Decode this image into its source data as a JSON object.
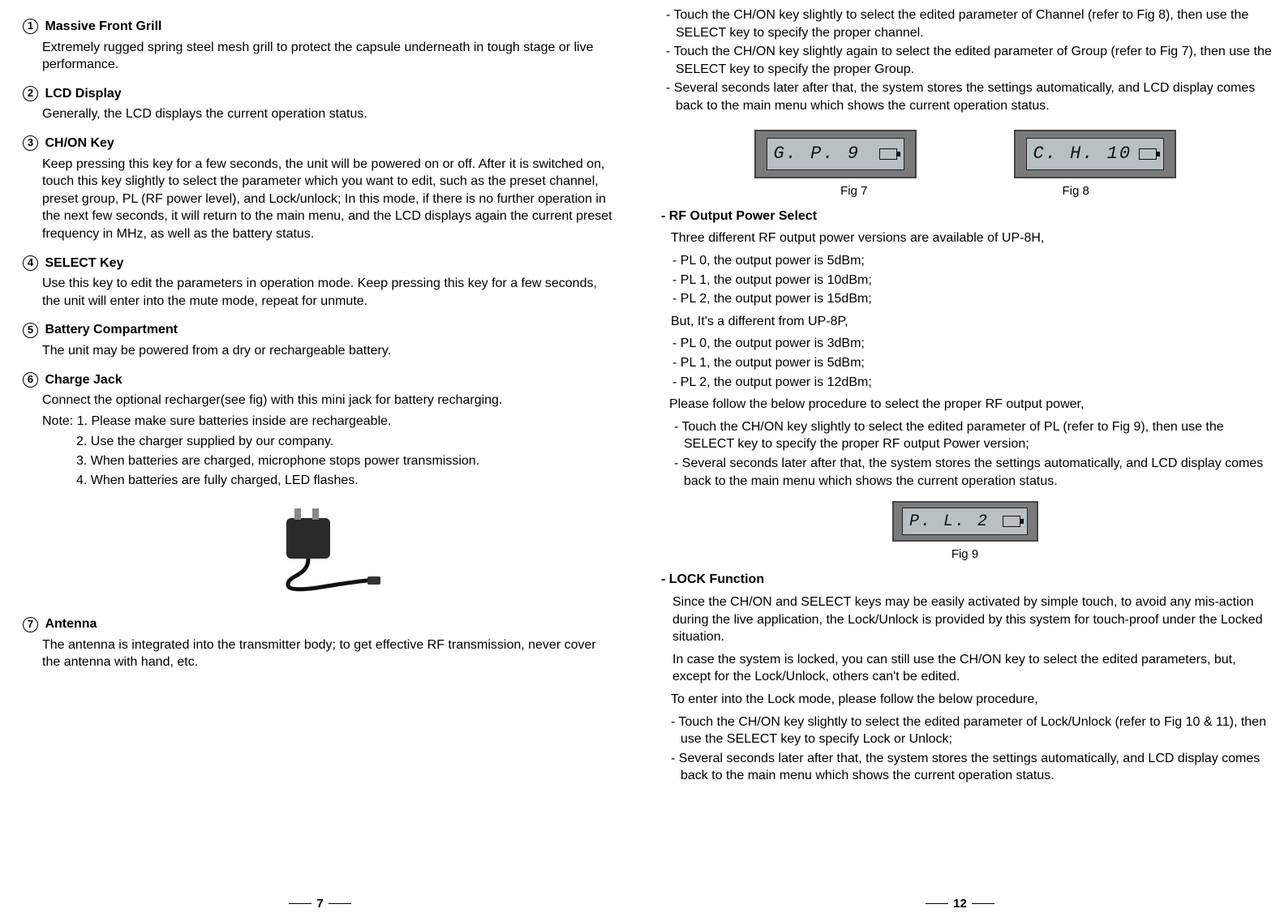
{
  "left": {
    "items": [
      {
        "num": "1",
        "title": "Massive Front Grill",
        "body": "Extremely rugged spring steel mesh grill to protect the capsule underneath in tough stage or live performance."
      },
      {
        "num": "2",
        "title": "LCD Display",
        "body": "Generally, the LCD displays the current operation status."
      },
      {
        "num": "3",
        "title": "CH/ON Key",
        "body": "Keep pressing this key for a few seconds, the unit will be powered on or off. After it is switched on, touch this key slightly to select the parameter which you want to edit, such as the preset channel, preset group, PL (RF power  level), and Lock/unlock; In this mode, if there is no further operation in the next few seconds, it will  return to the main menu, and the LCD displays again the current preset frequency in  MHz, as well as the battery status."
      },
      {
        "num": "4",
        "title": "SELECT Key",
        "body": "Use this key to edit the parameters in operation mode. Keep pressing this key for a few seconds, the unit will enter into the mute mode, repeat for unmute."
      },
      {
        "num": "5",
        "title": "Battery Compartment",
        "body": "The unit may be powered from a dry or rechargeable battery."
      },
      {
        "num": "6",
        "title": "Charge Jack",
        "body": "Connect the optional recharger(see fig) with this mini jack for battery recharging.",
        "note": "Note: 1. Please make sure batteries inside are rechargeable.",
        "note2": "2. Use the charger supplied by our company.",
        "note3": "3. When batteries are charged, microphone stops power transmission.",
        "note4": "4. When batteries are fully charged, LED flashes."
      },
      {
        "num": "7",
        "title": "Antenna",
        "body": "The antenna is integrated into the transmitter body; to get effective RF transmission, never cover the antenna with hand, etc."
      }
    ],
    "pagenum": "7"
  },
  "right": {
    "top": [
      "- Touch the CH/ON key slightly to select the edited parameter of Channel (refer to Fig 8), then  use the SELECT key to specify the proper channel.",
      "- Touch the CH/ON key slightly again to select the edited parameter of Group (refer to Fig 7), then use  the SELECT key to specify the proper Group.",
      "- Several seconds later after that, the system stores the settings automatically, and LCD display comes back to the main menu which shows the current operation status."
    ],
    "fig7_lcd": "G. P.      9",
    "fig8_lcd": "C. H.    10",
    "fig7": "Fig 7",
    "fig8": "Fig 8",
    "rf_title": "-  RF Output Power Select",
    "rf_intro": "Three different RF output power versions are available of UP-8H,",
    "rf_8h": [
      "- PL 0, the output power is 5dBm;",
      "- PL 1, the output power is 10dBm;",
      "- PL 2, the output power is 15dBm;"
    ],
    "rf_but": "But, It's a different from UP-8P,",
    "rf_8p": [
      "- PL 0, the output power is 3dBm;",
      "- PL 1, the output power is 5dBm;",
      "- PL 2, the output power is 12dBm;"
    ],
    "rf_follow": "Please follow the below procedure to select the proper RF output power,",
    "rf_steps": [
      "- Touch the CH/ON key slightly to select the edited parameter of PL (refer to Fig 9), then use the SELECT key to specify the proper RF output Power version;",
      "- Several seconds later after that, the system stores the settings automatically, and LCD display comes back to the main menu which shows the current operation status."
    ],
    "fig9_lcd": "P. L.      2",
    "fig9": "Fig 9",
    "lock_title": "-  LOCK  Function",
    "lock_p1": "Since the CH/ON and SELECT keys may be easily activated by simple touch, to avoid any mis-action during the live application, the Lock/Unlock is provided by this system for touch-proof under the Locked situation.",
    "lock_p2": "In case the system is locked, you can still use the CH/ON key to select the edited parameters, but, except for the Lock/Unlock, others can't be edited.",
    "lock_p3": "To enter into the Lock mode, please follow the below procedure,",
    "lock_steps": [
      "- Touch the CH/ON key slightly to select the edited parameter of Lock/Unlock (refer to Fig 10 & 11),  then use the SELECT key to specify Lock or Unlock;",
      "- Several seconds later after that, the system stores the settings automatically, and LCD display comes back to the main menu which shows the current operation status."
    ],
    "pagenum": "12"
  }
}
